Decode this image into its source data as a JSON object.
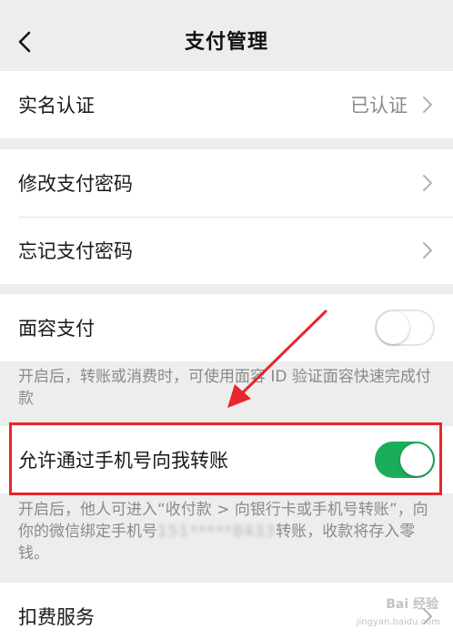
{
  "header": {
    "title": "支付管理"
  },
  "identity": {
    "label": "实名认证",
    "status": "已认证"
  },
  "password": {
    "change_label": "修改支付密码",
    "forgot_label": "忘记支付密码"
  },
  "face_pay": {
    "label": "面容支付",
    "enabled": false,
    "description": "开启后，转账或消费时，可使用面容 ID 验证面容快速完成付款"
  },
  "phone_transfer": {
    "label": "允许通过手机号向我转账",
    "enabled": true,
    "description_before": "开启后，他人可进入“收付款 > 向银行卡或手机号转账”，向你的微信绑定手机号",
    "phone_masked": "151*****8433",
    "description_after": "转账，收款将存入零钱。"
  },
  "deduction": {
    "label": "扣费服务"
  },
  "watermark": {
    "text": "Bai 经验",
    "url": "jingyan.baidu.com"
  },
  "colors": {
    "toggle_on": "#1aad5a",
    "highlight": "#e8262d",
    "background": "#ededed"
  }
}
